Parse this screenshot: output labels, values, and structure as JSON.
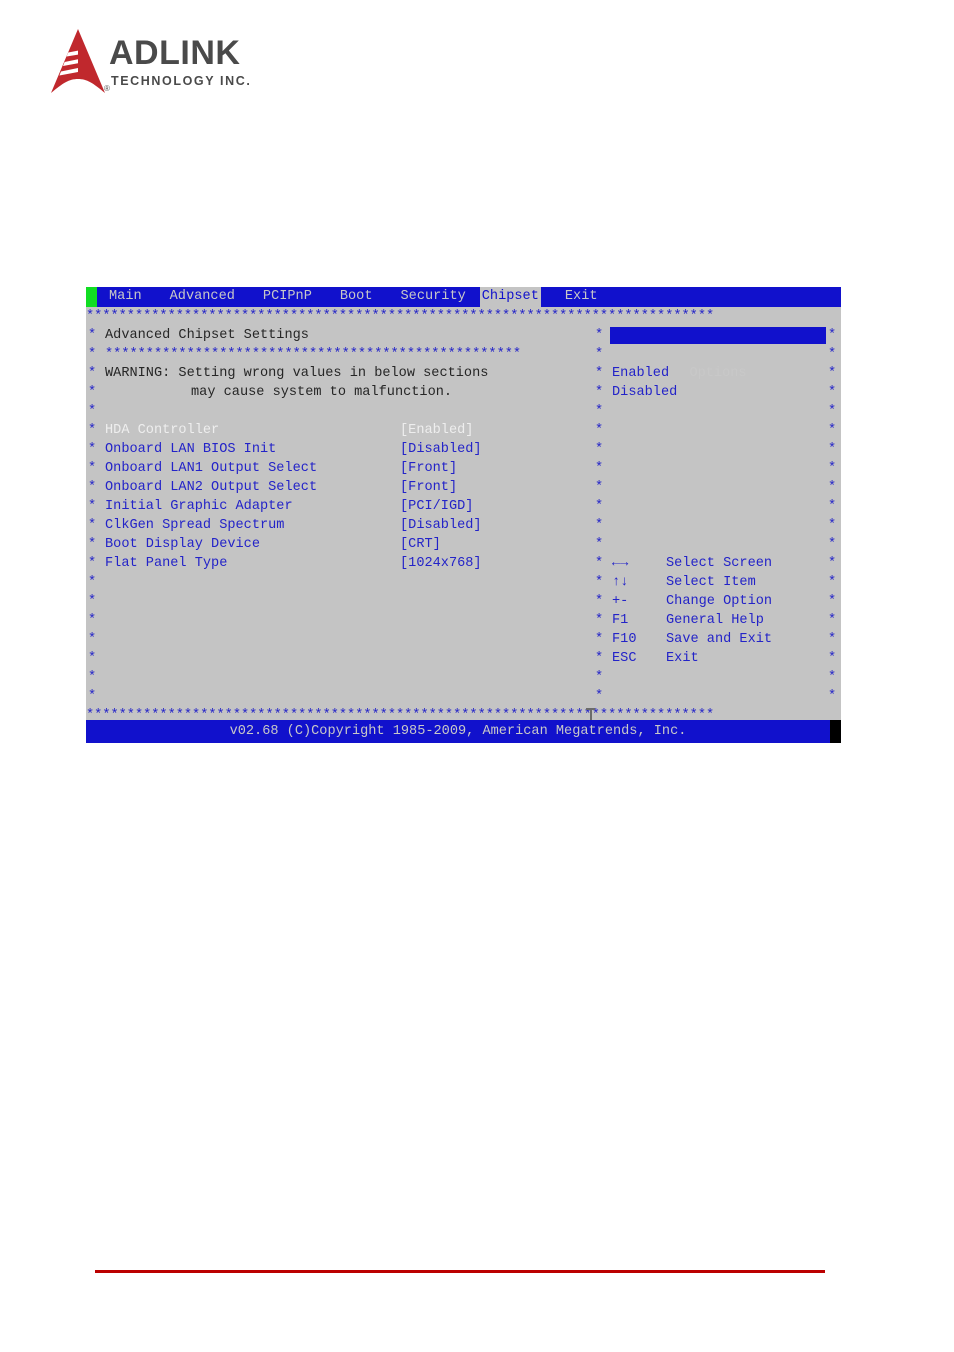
{
  "brand": {
    "name": "ADLINK",
    "tagline": "TECHNOLOGY INC.",
    "registered_mark": "®",
    "mark_color": "#c0282d",
    "word_color": "#4a4a4a"
  },
  "colors": {
    "terminal_background": "#c4c4c4",
    "terminal_blue": "#1111cc",
    "terminal_text_blue": "#2323c8",
    "terminal_text_light": "#c8c8c8",
    "terminal_text_dark": "#262626",
    "terminal_text_disabled": "#eeeeee",
    "cursor_marker_green": "#11dd22",
    "page_rule_red": "#bb0000"
  },
  "bios": {
    "menubar": {
      "tabs": [
        {
          "label": "Main",
          "active": false
        },
        {
          "label": "Advanced",
          "active": false
        },
        {
          "label": "PCIPnP",
          "active": false
        },
        {
          "label": "Boot",
          "active": false
        },
        {
          "label": "Security",
          "active": false
        },
        {
          "label": "Chipset",
          "active": true
        },
        {
          "label": "Exit",
          "active": false
        }
      ]
    },
    "rule_top": "*****************************************************************************",
    "rule_mid": "***************************************************",
    "rule_bottom": "*****************************************************************************",
    "star": "*",
    "section_title": "Advanced Chipset Settings",
    "warning": {
      "line1": "WARNING: Setting wrong values in below sections",
      "line2": "may cause system to malfunction."
    },
    "settings": [
      {
        "label": "HDA Controller",
        "value": "[Enabled]",
        "disabled": true
      },
      {
        "label": "Onboard LAN BIOS Init",
        "value": "[Disabled]",
        "disabled": false
      },
      {
        "label": "Onboard LAN1 Output Select",
        "value": "[Front]",
        "disabled": false
      },
      {
        "label": "Onboard LAN2 Output Select",
        "value": "[Front]",
        "disabled": false
      },
      {
        "label": "Initial Graphic Adapter",
        "value": "[PCI/IGD]",
        "disabled": false
      },
      {
        "label": "ClkGen Spread Spectrum",
        "value": "[Disabled]",
        "disabled": false
      },
      {
        "label": "Boot Display Device",
        "value": "[CRT]",
        "disabled": false
      },
      {
        "label": "Flat Panel Type",
        "value": "[1024x768]",
        "disabled": false
      }
    ],
    "options_panel": {
      "title": "Options",
      "items": [
        "Enabled",
        "Disabled"
      ]
    },
    "help_legend": [
      {
        "key": "←→",
        "action": "Select Screen"
      },
      {
        "key": "↑↓",
        "action": "Select Item"
      },
      {
        "key": "+-",
        "action": "Change Option"
      },
      {
        "key": "F1",
        "action": "General Help"
      },
      {
        "key": "F10",
        "action": "Save and Exit"
      },
      {
        "key": "ESC",
        "action": "Exit"
      }
    ],
    "footer": "v02.68 (C)Copyright 1985-2009, American Megatrends, Inc."
  }
}
